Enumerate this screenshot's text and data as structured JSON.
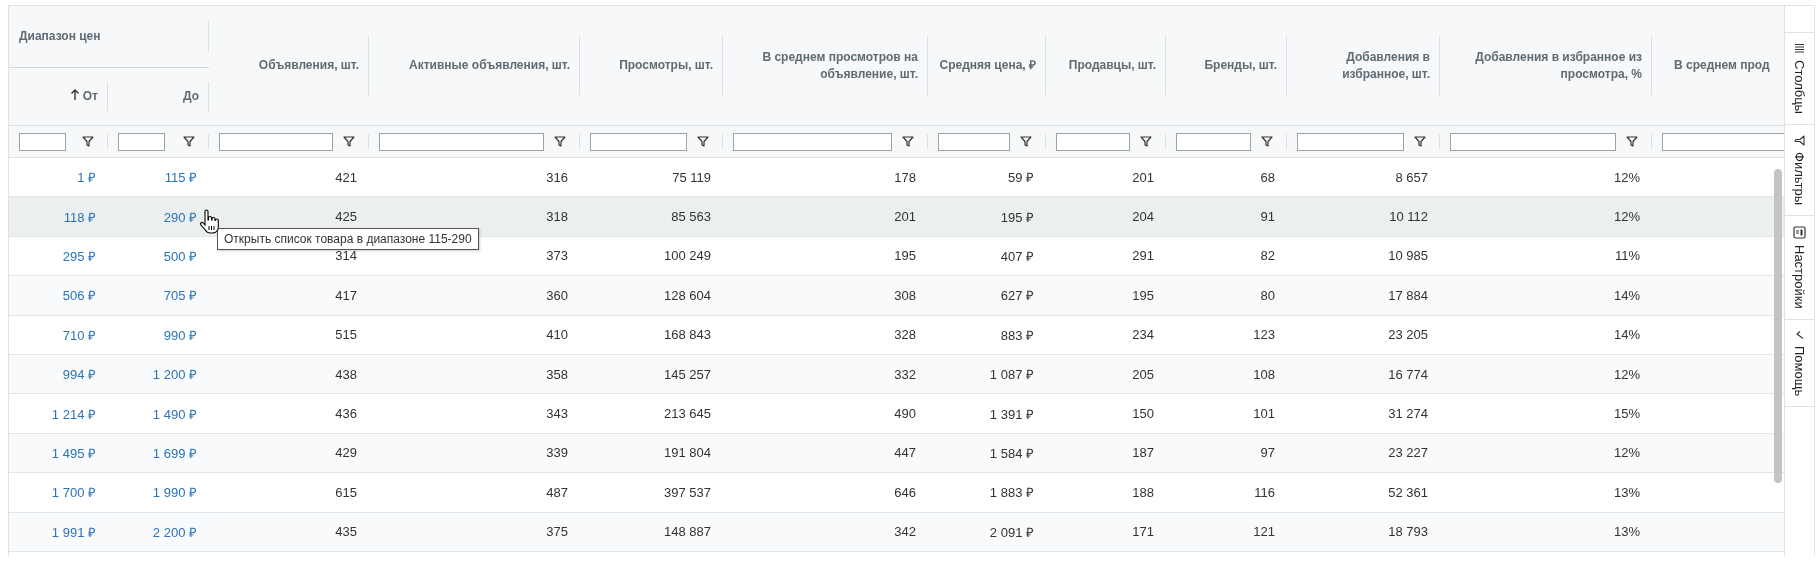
{
  "table": {
    "group_header": {
      "label": "Диапазон цен"
    },
    "columns": [
      {
        "label": "От",
        "kind": "link",
        "sorted": true
      },
      {
        "label": "До",
        "kind": "link",
        "sorted": false
      },
      {
        "label": "Объявления, шт.",
        "kind": "number",
        "sorted": false
      },
      {
        "label": "Активные объявления, шт.",
        "kind": "number",
        "sorted": false
      },
      {
        "label": "Просмотры, шт.",
        "kind": "number",
        "sorted": false
      },
      {
        "label": "В среднем просмотров на объявление, шт.",
        "kind": "number",
        "sorted": false
      },
      {
        "label": "Средняя цена, ₽",
        "kind": "number",
        "sorted": false
      },
      {
        "label": "Продавцы, шт.",
        "kind": "number",
        "sorted": false
      },
      {
        "label": "Бренды, шт.",
        "kind": "number",
        "sorted": false
      },
      {
        "label": "Добавления в избранное, шт.",
        "kind": "number",
        "sorted": false
      },
      {
        "label": "Добавления в избранное из просмотра, %",
        "kind": "number",
        "sorted": false
      },
      {
        "label": "В среднем прод",
        "sorted": false
      }
    ],
    "rows": [
      {
        "hovered": false,
        "cells": [
          "1 ₽",
          "115 ₽",
          "421",
          "316",
          "75 119",
          "178",
          "59 ₽",
          "201",
          "68",
          "8 657",
          "12%"
        ]
      },
      {
        "hovered": true,
        "cells": [
          "118 ₽",
          "290 ₽",
          "425",
          "318",
          "85 563",
          "201",
          "195 ₽",
          "204",
          "91",
          "10 112",
          "12%"
        ]
      },
      {
        "hovered": false,
        "cells": [
          "295 ₽",
          "500 ₽",
          "314",
          "373",
          "100 249",
          "195",
          "407 ₽",
          "291",
          "82",
          "10 985",
          "11%"
        ]
      },
      {
        "hovered": false,
        "cells": [
          "506 ₽",
          "705 ₽",
          "417",
          "360",
          "128 604",
          "308",
          "627 ₽",
          "195",
          "80",
          "17 884",
          "14%"
        ]
      },
      {
        "hovered": false,
        "cells": [
          "710 ₽",
          "990 ₽",
          "515",
          "410",
          "168 843",
          "328",
          "883 ₽",
          "234",
          "123",
          "23 205",
          "14%"
        ]
      },
      {
        "hovered": false,
        "cells": [
          "994 ₽",
          "1 200 ₽",
          "438",
          "358",
          "145 257",
          "332",
          "1 087 ₽",
          "205",
          "108",
          "16 774",
          "12%"
        ]
      },
      {
        "hovered": false,
        "cells": [
          "1 214 ₽",
          "1 490 ₽",
          "436",
          "343",
          "213 645",
          "490",
          "1 391 ₽",
          "150",
          "101",
          "31 274",
          "15%"
        ]
      },
      {
        "hovered": false,
        "cells": [
          "1 495 ₽",
          "1 699 ₽",
          "429",
          "339",
          "191 804",
          "447",
          "1 584 ₽",
          "187",
          "97",
          "23 227",
          "12%"
        ]
      },
      {
        "hovered": false,
        "cells": [
          "1 700 ₽",
          "1 990 ₽",
          "615",
          "487",
          "397 537",
          "646",
          "1 883 ₽",
          "188",
          "116",
          "52 361",
          "13%"
        ]
      },
      {
        "hovered": false,
        "cells": [
          "1 991 ₽",
          "2 200 ₽",
          "435",
          "375",
          "148 887",
          "342",
          "2 091 ₽",
          "171",
          "121",
          "18 793",
          "13%"
        ]
      }
    ],
    "tooltip": {
      "text": "Открыть список товара в диапазоне 115-290"
    }
  },
  "side_panel": {
    "tabs": [
      {
        "label": "Столбцы"
      },
      {
        "label": "Фильтры"
      },
      {
        "label": "Настройки"
      },
      {
        "label": "Помощь"
      }
    ]
  }
}
